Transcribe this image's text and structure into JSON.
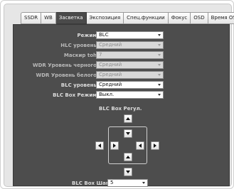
{
  "tabs": [
    {
      "label": "SSDR",
      "active": false
    },
    {
      "label": "WB",
      "active": false
    },
    {
      "label": "Засветка",
      "active": true
    },
    {
      "label": "Экспозиция",
      "active": false
    },
    {
      "label": "Спец.функции",
      "active": false
    },
    {
      "label": "Фокус",
      "active": false
    },
    {
      "label": "OSD",
      "active": false
    },
    {
      "label": "Время OSD",
      "active": false
    }
  ],
  "fields": {
    "mode": {
      "label": "Режим",
      "value": "BLC"
    },
    "hlc_level": {
      "label": "HLC уровень",
      "value": "Средний"
    },
    "mask_tone": {
      "label": "Маскир toh",
      "value": "7"
    },
    "wdr_black": {
      "label": "WDR Уровень черного",
      "value": "Средний"
    },
    "wdr_white": {
      "label": "WDR Уровень белого",
      "value": "Средний"
    },
    "blc_level": {
      "label": "BLC уровень",
      "value": "Средний"
    },
    "blc_box_mode": {
      "label": "BLC Box Режим",
      "value": "Выкл."
    }
  },
  "blc_box": {
    "title": "BLC Box Регул.",
    "step_label": "BLC Box Шаг",
    "step_value": "5"
  }
}
